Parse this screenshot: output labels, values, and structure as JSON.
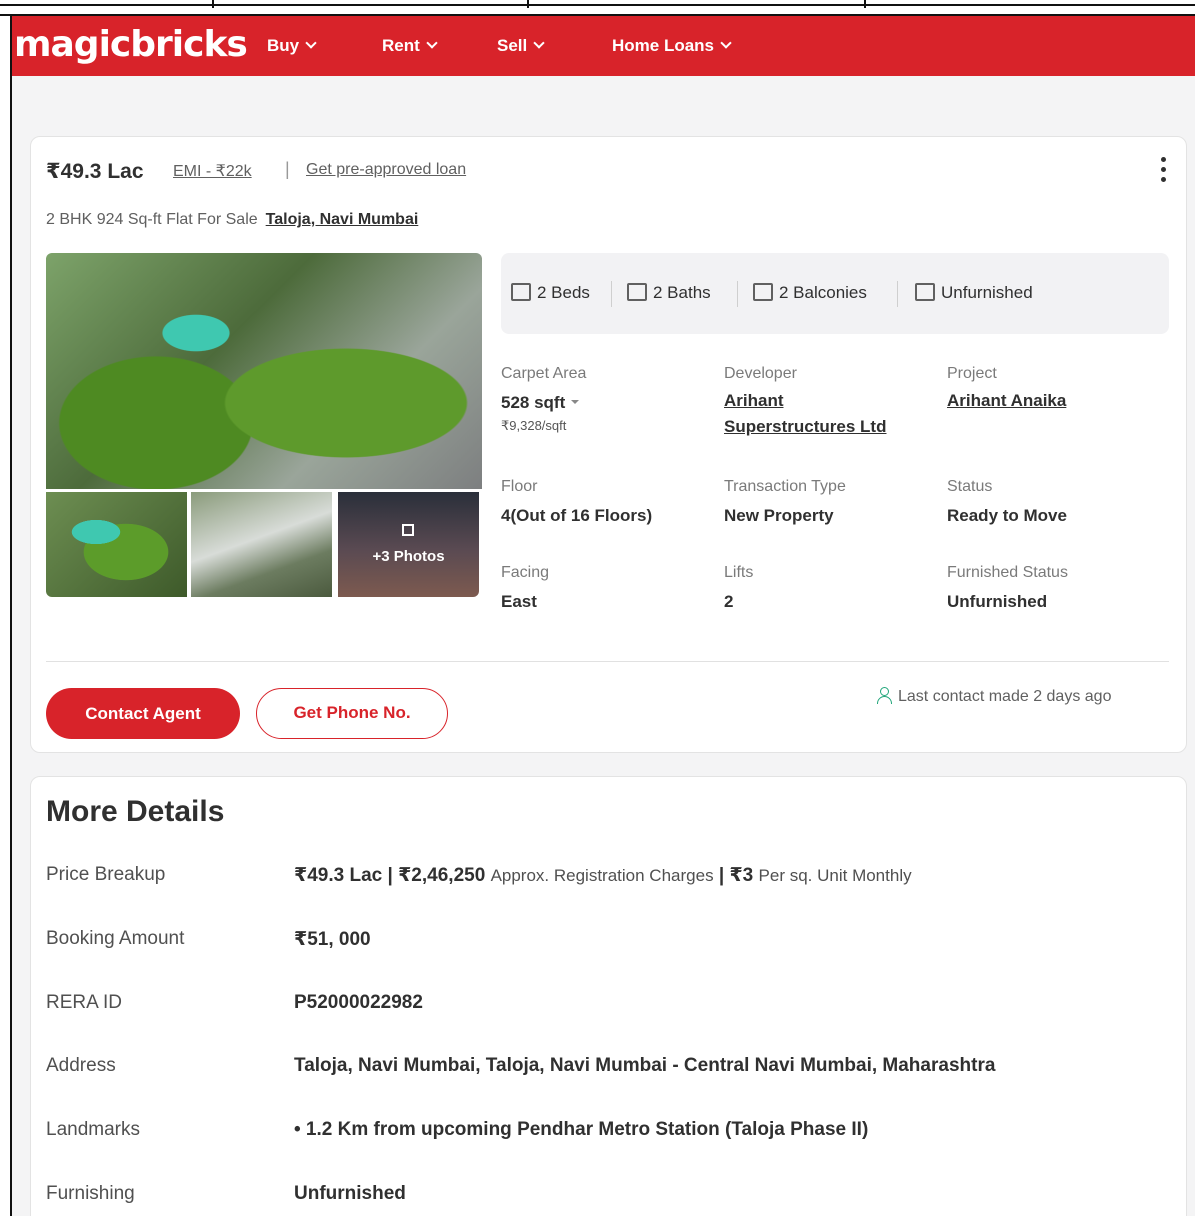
{
  "header": {
    "logo": "magicbricks",
    "nav": [
      "Buy",
      "Rent",
      "Sell",
      "Home Loans"
    ]
  },
  "listing": {
    "price": "₹49.3 Lac",
    "emi": "EMI - ₹22k",
    "separator": "|",
    "preapproved": "Get pre-approved loan",
    "subtitle": "2 BHK 924 Sq-ft Flat For Sale",
    "location": "Taloja, Navi Mumbai",
    "photos_more": "+3 Photos",
    "amenities": [
      "2 Beds",
      "2 Baths",
      "2 Balconies",
      "Unfurnished"
    ],
    "details": {
      "carpet_area_label": "Carpet Area",
      "carpet_area_value": "528 sqft",
      "price_per_sqft": "₹9,328/sqft",
      "developer_label": "Developer",
      "developer_line1": "Arihant",
      "developer_line2": "Superstructures Ltd",
      "project_label": "Project",
      "project_value": "Arihant Anaika",
      "floor_label": "Floor",
      "floor_value": "4(Out of 16 Floors)",
      "transaction_label": "Transaction Type",
      "transaction_value": "New Property",
      "status_label": "Status",
      "status_value": "Ready to Move",
      "facing_label": "Facing",
      "facing_value": "East",
      "lifts_label": "Lifts",
      "lifts_value": "2",
      "furnished_label": "Furnished Status",
      "furnished_value": "Unfurnished"
    },
    "contact_button": "Contact Agent",
    "phone_button": "Get Phone No.",
    "last_contact": "Last contact made 2 days ago"
  },
  "more_details": {
    "title": "More Details",
    "price_breakup_label": "Price Breakup",
    "price_breakup_part1": "₹49.3 Lac | ₹2,46,250",
    "price_breakup_part2": "Approx. Registration Charges",
    "price_breakup_part3": "| ₹3",
    "price_breakup_part4": "Per sq. Unit Monthly",
    "booking_label": "Booking Amount",
    "booking_value": "₹51, 000",
    "rera_label": "RERA ID",
    "rera_value": "P52000022982",
    "address_label": "Address",
    "address_value": "Taloja, Navi Mumbai, Taloja, Navi Mumbai - Central Navi Mumbai, Maharashtra",
    "landmarks_label": "Landmarks",
    "landmarks_value": "• 1.2 Km from upcoming Pendhar Metro Station (Taloja Phase II)",
    "furnishing_label": "Furnishing",
    "furnishing_value": "Unfurnished"
  },
  "colors": {
    "brand": "#d8232a",
    "accent_green": "#21a67a"
  }
}
